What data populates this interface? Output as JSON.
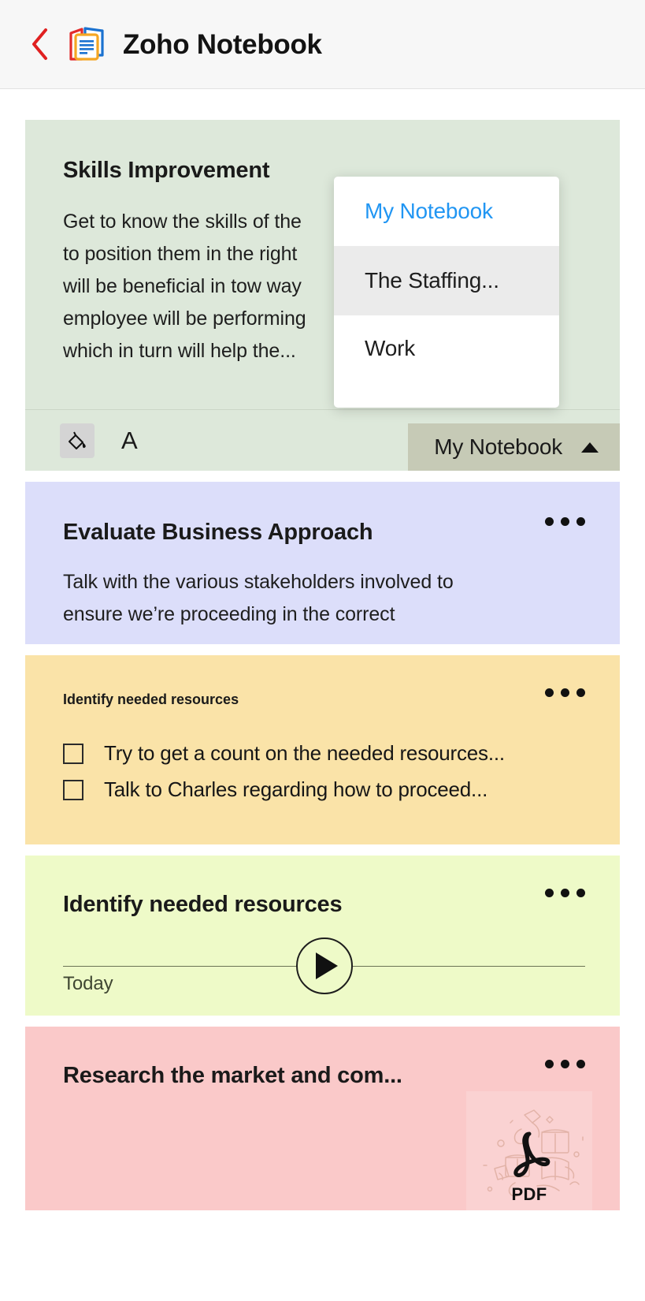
{
  "header": {
    "back_icon": "chevron-left-icon",
    "back_icon_color": "#e02020",
    "app_icon": "zoho-notebook-icon",
    "title": "Zoho Notebook"
  },
  "notes": [
    {
      "id": "skills-improvement",
      "type": "text-note",
      "color": "#dde8da",
      "title": "Skills Improvement",
      "body_lines": [
        "Get to know the skills of the",
        "to position them in the right",
        "will be beneficial in tow way",
        "employee will be performing",
        "which in turn will help the..."
      ],
      "footer": {
        "fill_icon": "paint-bucket-icon",
        "font_icon_label": "A",
        "notebook_button_label": "My Notebook",
        "notebook_button_caret": "caret-up-icon",
        "notebook_button_color": "#c6cab6"
      }
    },
    {
      "id": "evaluate-business-approach",
      "type": "text-note",
      "color": "#dcdefa",
      "title": "Evaluate Business Approach",
      "body_lines": [
        "Talk with the various stakeholders involved to",
        "ensure we’re proceeding in the correct"
      ],
      "menu_icon": "more-options-icon"
    },
    {
      "id": "identify-needed-resources-checklist",
      "type": "checklist-note",
      "color": "#fae3a8",
      "heading": "Identify needed resources",
      "menu_icon": "more-options-icon",
      "items": [
        {
          "label": "Try to get a count on the needed resources...",
          "checked": false
        },
        {
          "label": "Talk to Charles regarding how to proceed...",
          "checked": false
        }
      ]
    },
    {
      "id": "identify-needed-resources-audio",
      "type": "audio-note",
      "color": "#eefac8",
      "title": "Identify needed resources",
      "menu_icon": "more-options-icon",
      "play_icon": "play-icon",
      "date_label": "Today"
    },
    {
      "id": "research-the-market",
      "type": "file-note",
      "color": "#fac9c9",
      "title": "Research the market and com...",
      "menu_icon": "more-options-icon",
      "attachment": {
        "file_type_label": "PDF",
        "file_icon": "pdf-acrobat-icon",
        "thumbnail": "doodle-books-illustration"
      }
    }
  ],
  "dropdown": {
    "visible": true,
    "items": [
      {
        "label": "My Notebook",
        "state": "selected"
      },
      {
        "label": "The Staffing...",
        "state": "hovered"
      },
      {
        "label": "Work",
        "state": "normal"
      }
    ],
    "selected_color": "#2196f3",
    "hover_color": "#ebebeb"
  }
}
